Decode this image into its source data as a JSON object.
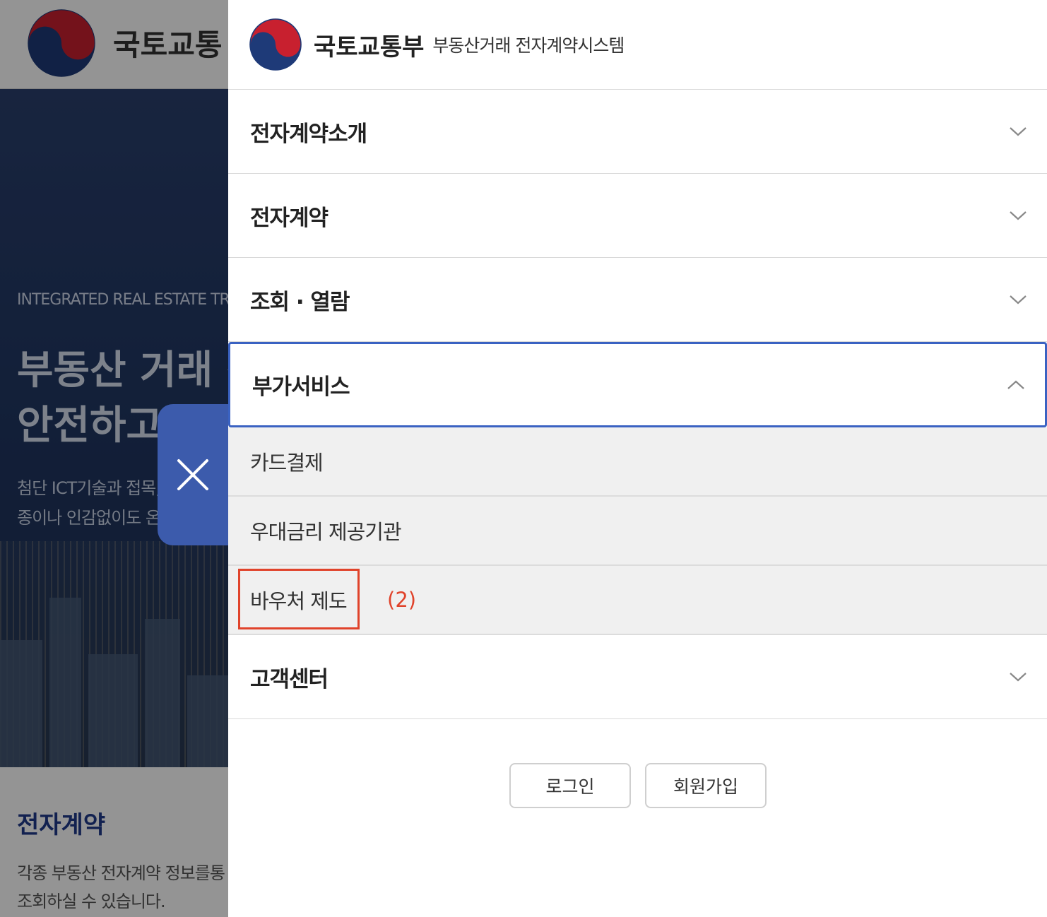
{
  "background": {
    "org_name": "국토교통",
    "hero": {
      "subtitle": "INTEGRATED REAL ESTATE TRA",
      "title_line1": "부동산 거래 전",
      "title_line2": "안전하고",
      "desc_line1": "첨단 ICT기술과 접목,",
      "desc_line2": "종이나 인감없이도 온"
    },
    "section": {
      "title": "전자계약",
      "desc_line1": "각종 부동산 전자계약 정보를통",
      "desc_line2": "조회하실 수 있습니다."
    }
  },
  "drawer": {
    "org_name": "국토교통부",
    "system_name": "부동산거래 전자계약시스템",
    "menu": [
      {
        "label": "전자계약소개",
        "state": "collapsed"
      },
      {
        "label": "전자계약",
        "state": "collapsed"
      },
      {
        "label": "조회 · 열람",
        "state": "collapsed"
      },
      {
        "label": "부가서비스",
        "state": "expanded"
      },
      {
        "label": "고객센터",
        "state": "collapsed"
      }
    ],
    "submenu": [
      {
        "label": "카드결제"
      },
      {
        "label": "우대금리 제공기관"
      },
      {
        "label": "바우처 제도"
      }
    ],
    "annotation": "(2)",
    "login_label": "로그인",
    "signup_label": "회원가입"
  },
  "colors": {
    "accent_blue": "#3a62c2",
    "close_button": "#3c5bac",
    "highlight_red": "#e0432b",
    "emblem_red": "#c8202f",
    "emblem_blue": "#1e3a78"
  },
  "icons": {
    "close": "close-icon",
    "expand": "chevron-down-icon",
    "collapse": "chevron-up-icon",
    "emblem": "government-emblem-icon"
  }
}
